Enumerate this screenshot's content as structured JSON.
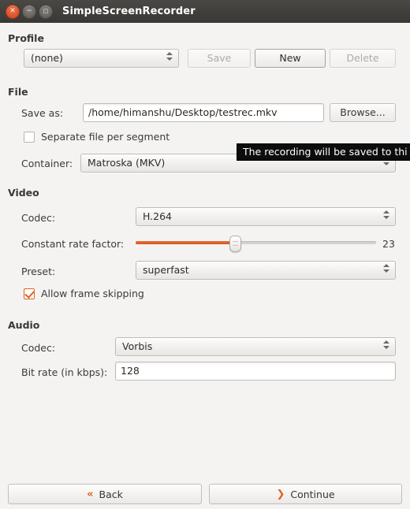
{
  "window": {
    "title": "SimpleScreenRecorder",
    "controls": {
      "close_label": "✕",
      "minimize_label": "−",
      "maximize_label": "□"
    },
    "colors": {
      "titlebar": "#3a3835",
      "accent": "#dd6222",
      "background": "#f4f3f2"
    }
  },
  "profile": {
    "section_label": "Profile",
    "combo_value": "(none)",
    "save_label": "Save",
    "new_label": "New",
    "delete_label": "Delete"
  },
  "file": {
    "section_label": "File",
    "save_as_label": "Save as:",
    "save_as_value": "/home/himanshu/Desktop/testrec.mkv",
    "browse_label": "Browse...",
    "separate_file_label": "Separate file per segment",
    "separate_file_checked": false,
    "container_label": "Container:",
    "container_value": "Matroska (MKV)",
    "tooltip_text": "The recording will be saved to thi"
  },
  "video": {
    "section_label": "Video",
    "codec_label": "Codec:",
    "codec_value": "H.264",
    "crf_label": "Constant rate factor:",
    "crf_value": "23",
    "crf_percent": 41,
    "preset_label": "Preset:",
    "preset_value": "superfast",
    "frame_skipping_label": "Allow frame skipping",
    "frame_skipping_checked": true
  },
  "audio": {
    "section_label": "Audio",
    "codec_label": "Codec:",
    "codec_value": "Vorbis",
    "bitrate_label": "Bit rate (in kbps):",
    "bitrate_value": "128"
  },
  "footer": {
    "back_label": "Back",
    "back_icon": "«",
    "continue_label": "Continue",
    "continue_icon": "❯"
  }
}
